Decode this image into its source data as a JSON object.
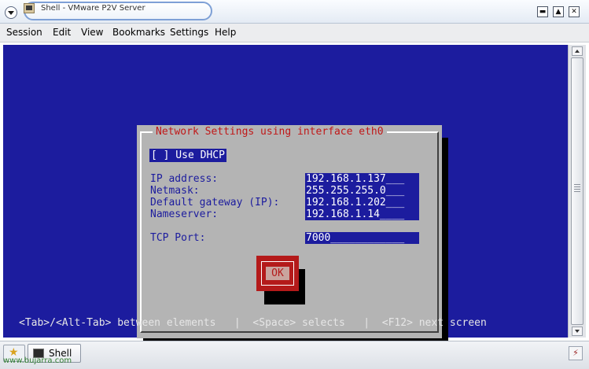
{
  "window": {
    "title": "Shell - VMware P2V Server",
    "minimize_glyph": "▬",
    "maximize_glyph": "▲",
    "close_glyph": "✕"
  },
  "menubar": {
    "items": [
      "Session",
      "Edit",
      "View",
      "Bookmarks",
      "Settings",
      "Help"
    ]
  },
  "dialog": {
    "title": "Network Settings using interface eth0",
    "dhcp_checkbox": "[ ] Use DHCP",
    "fields": [
      {
        "label": "IP address:",
        "value": "192.168.1.137___"
      },
      {
        "label": "Netmask:",
        "value": "255.255.255.0___"
      },
      {
        "label": "Default gateway (IP):",
        "value": "192.168.1.202___"
      },
      {
        "label": "Nameserver:",
        "value": "192.168.1.14____"
      },
      {
        "label": "TCP Port:",
        "value": "7000____________"
      }
    ],
    "ok_label": "OK"
  },
  "hint_line": "<Tab>/<Alt-Tab> between elements   |  <Space> selects   |  <F12> next screen",
  "taskbar": {
    "task_label": "Shell",
    "watermark": "www.bujarra.com"
  },
  "colors": {
    "terminal_bg": "#1c1c9e",
    "dialog_bg": "#b4b4b4",
    "dialog_title": "#c01818",
    "ok_frame": "#b41a1a"
  }
}
